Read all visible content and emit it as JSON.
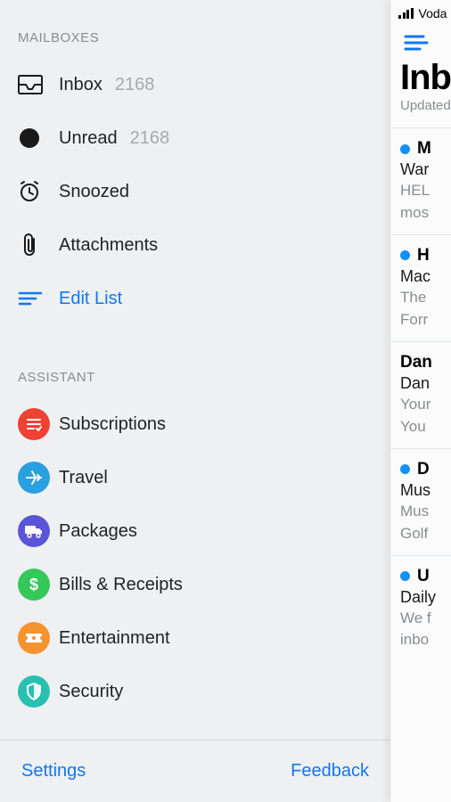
{
  "status_bar": {
    "carrier": "Voda"
  },
  "content": {
    "title": "Inb",
    "subtitle": "Updated"
  },
  "messages": [
    {
      "unread": true,
      "sender": "M",
      "subject": "War",
      "snip1": "HEL",
      "snip2": "mos"
    },
    {
      "unread": true,
      "sender": "H",
      "subject": "Mac",
      "snip1": "The",
      "snip2": "Forr"
    },
    {
      "unread": false,
      "sender": "Dan",
      "subject": "Dan",
      "snip1": "Your",
      "snip2": "You"
    },
    {
      "unread": true,
      "sender": "D",
      "subject": "Mus",
      "snip1": "Mus",
      "snip2": "Golf"
    },
    {
      "unread": true,
      "sender": "U",
      "subject": "Daily",
      "snip1": "We f",
      "snip2": "inbo"
    }
  ],
  "sections": {
    "mailboxes": {
      "header": "MAILBOXES",
      "items": [
        {
          "icon": "inbox",
          "label": "Inbox",
          "count": "2168"
        },
        {
          "icon": "dot",
          "label": "Unread",
          "count": "2168"
        },
        {
          "icon": "clock",
          "label": "Snoozed"
        },
        {
          "icon": "attachment",
          "label": "Attachments"
        },
        {
          "icon": "editlist",
          "label": "Edit List",
          "link": true
        }
      ]
    },
    "assistant": {
      "header": "ASSISTANT",
      "items": [
        {
          "icon": "subscriptions",
          "color": "#ef4134",
          "label": "Subscriptions"
        },
        {
          "icon": "travel",
          "color": "#29a0e0",
          "label": "Travel"
        },
        {
          "icon": "packages",
          "color": "#5a55d6",
          "label": "Packages"
        },
        {
          "icon": "bills",
          "color": "#34c759",
          "label": "Bills & Receipts"
        },
        {
          "icon": "entertainment",
          "color": "#f59331",
          "label": "Entertainment"
        },
        {
          "icon": "security",
          "color": "#29c0b1",
          "label": "Security"
        }
      ]
    }
  },
  "footer": {
    "settings": "Settings",
    "feedback": "Feedback"
  }
}
